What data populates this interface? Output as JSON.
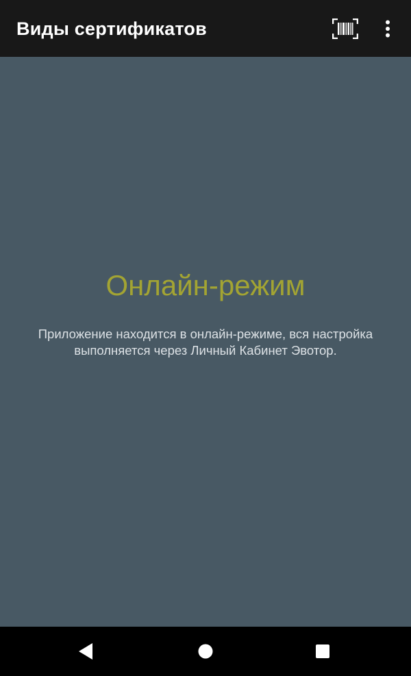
{
  "app_bar": {
    "title": "Виды сертификатов",
    "barcode_icon": "barcode-scan-icon",
    "more_icon": "more-vertical-icon"
  },
  "main": {
    "mode_title": "Онлайн-режим",
    "mode_description": "Приложение находится в онлайн-режиме, вся настройка выполняется через Личный Кабинет Эвотор."
  },
  "nav_bar": {
    "back_icon": "back-triangle-icon",
    "home_icon": "home-circle-icon",
    "recents_icon": "recents-square-icon"
  },
  "colors": {
    "app_bar_bg": "#181818",
    "content_bg": "#485964",
    "accent_title": "#a3a433",
    "desc_text": "#dde2e6",
    "nav_bg": "#000000"
  }
}
